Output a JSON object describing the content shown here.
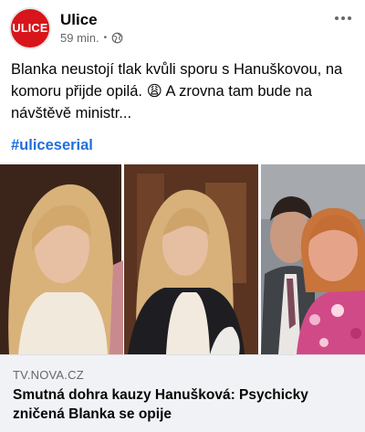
{
  "post": {
    "page_name": "Ulice",
    "avatar_text": "ULICE",
    "time": "59 min.",
    "separator": "•",
    "privacy_icon": "globe-icon",
    "more_icon": "more-options-icon",
    "text": "Blanka neustojí tlak kvůli sporu s Hanuškovou, na komoru přijde opilá. 😩 A zrovna tam bude na návštěvě ministr...",
    "hashtag": "#uliceserial"
  },
  "link_preview": {
    "domain": "TV.NOVA.CZ",
    "title": "Smutná dohra kauzy Hanušková: Psychicky zničená Blanka se opije"
  },
  "colors": {
    "brand_red": "#d7151b",
    "hashtag_blue": "#216fdb",
    "meta_gray": "#65676b",
    "card_bg": "#f0f2f5"
  }
}
